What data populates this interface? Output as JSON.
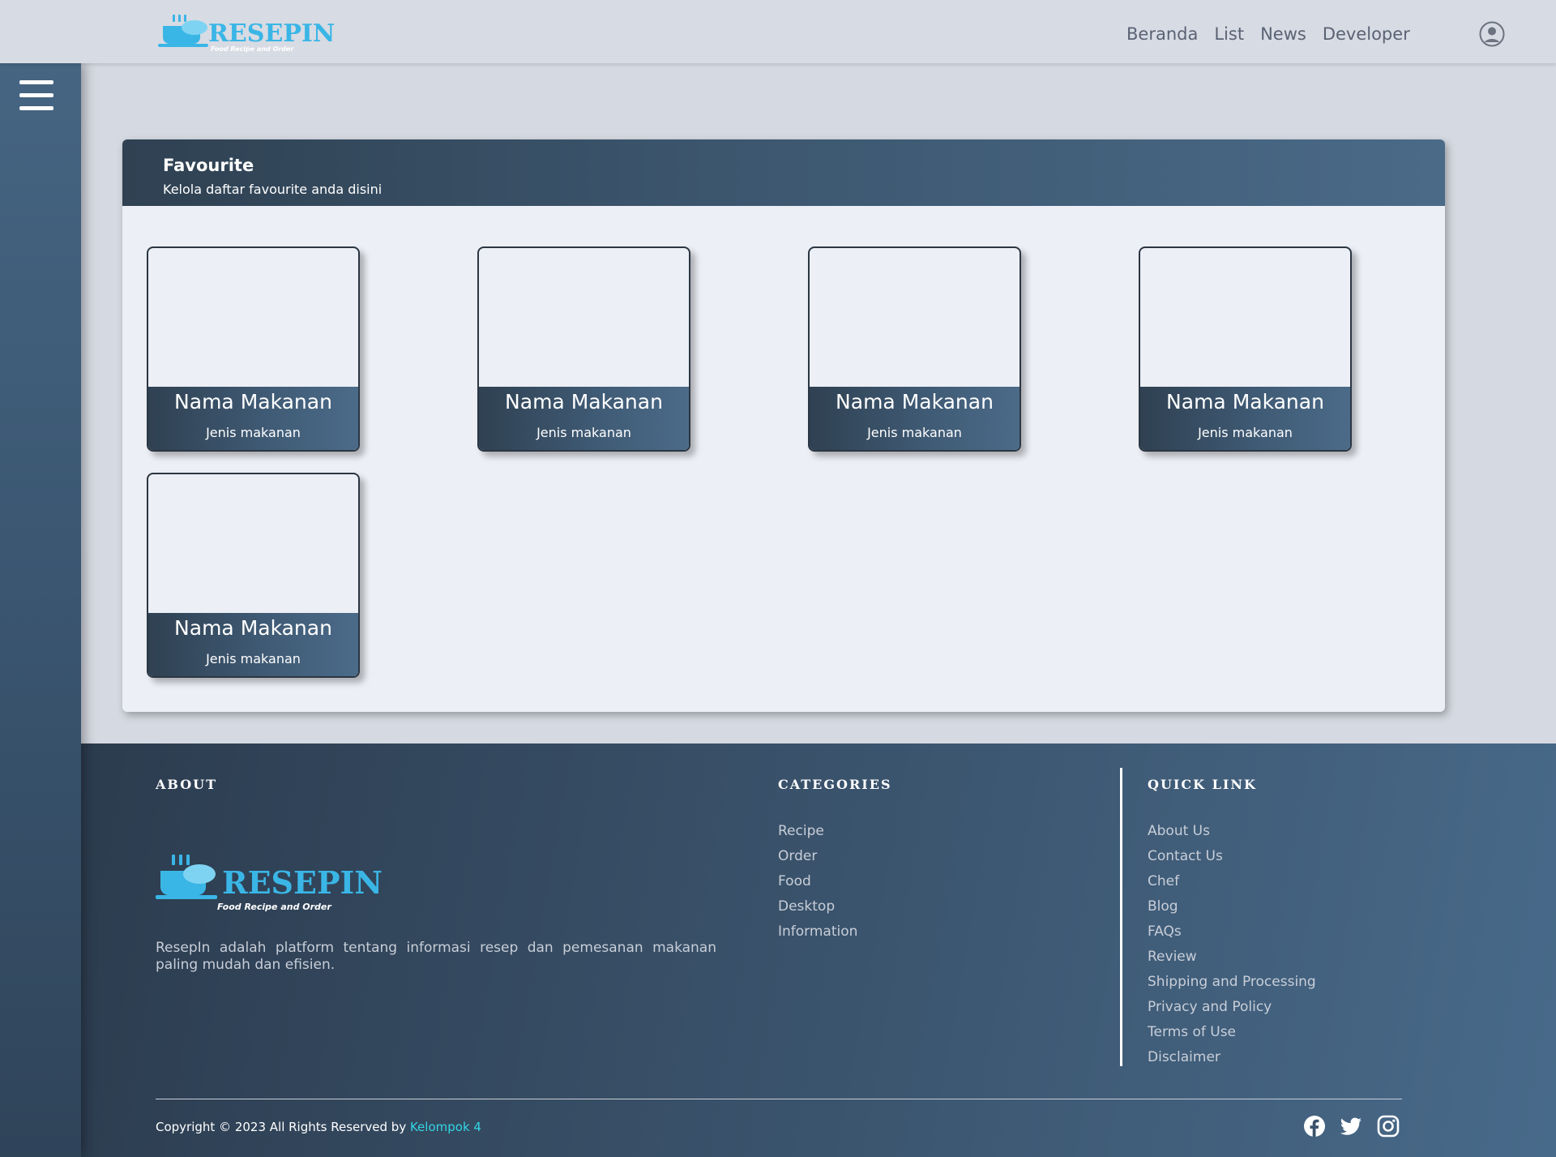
{
  "brand": {
    "name": "RESEPIN",
    "tagline": "Food Recipe and Order",
    "accent": "#3ab6e6"
  },
  "nav": {
    "links": [
      "Beranda",
      "List",
      "News",
      "Developer"
    ]
  },
  "panel": {
    "title": "Favourite",
    "subtitle": "Kelola daftar favourite anda disini"
  },
  "cards": [
    {
      "name": "Nama Makanan",
      "type": "Jenis makanan"
    },
    {
      "name": "Nama Makanan",
      "type": "Jenis makanan"
    },
    {
      "name": "Nama Makanan",
      "type": "Jenis makanan"
    },
    {
      "name": "Nama Makanan",
      "type": "Jenis makanan"
    },
    {
      "name": "Nama Makanan",
      "type": "Jenis makanan"
    }
  ],
  "footer": {
    "about": {
      "heading": "ABOUT",
      "text": "ResepIn adalah platform tentang informasi resep dan pemesanan makanan paling mudah dan efisien."
    },
    "categories": {
      "heading": "CATEGORIES",
      "items": [
        "Recipe",
        "Order",
        "Food",
        "Desktop",
        "Information"
      ]
    },
    "quick_link": {
      "heading": "QUICK LINK",
      "items": [
        "About Us",
        "Contact Us",
        "Chef",
        "Blog",
        "FAQs",
        "Review",
        "Shipping and Processing",
        "Privacy and Policy",
        "Terms of Use",
        "Disclaimer"
      ]
    },
    "copyright_prefix": "Copyright © 2023 All Rights Reserved by ",
    "copyright_team": "Kelompok 4",
    "social_icons": [
      "facebook-icon",
      "twitter-icon",
      "instagram-icon"
    ]
  }
}
